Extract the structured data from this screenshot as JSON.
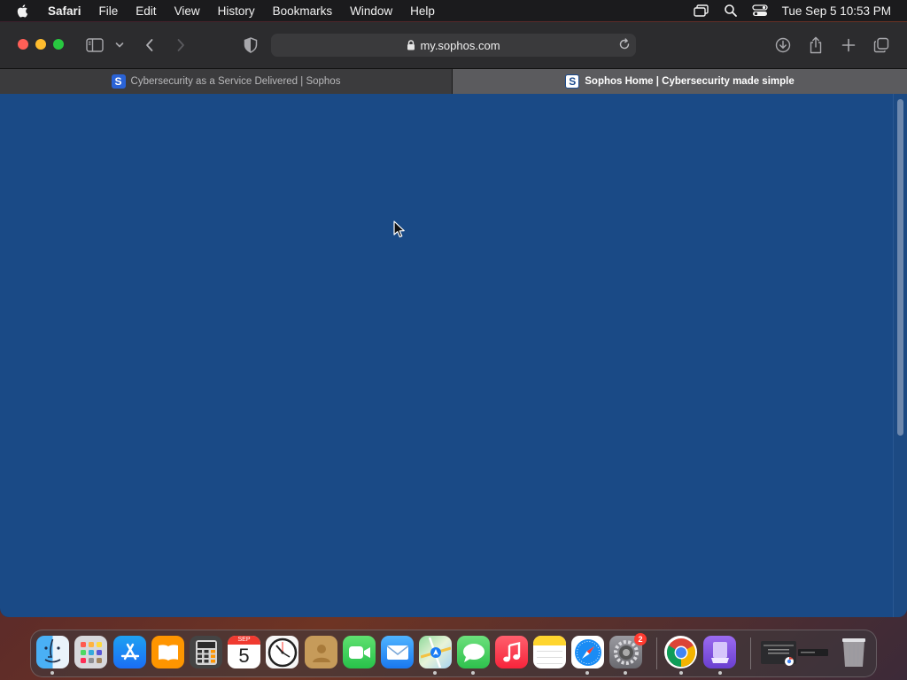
{
  "menubar": {
    "app_name": "Safari",
    "items": [
      "File",
      "Edit",
      "View",
      "History",
      "Bookmarks",
      "Window",
      "Help"
    ],
    "clock": "Tue Sep 5  10:53 PM"
  },
  "browser": {
    "url": "my.sophos.com",
    "tabs": [
      {
        "title": "Cybersecurity as a Service Delivered | Sophos",
        "favicon": "S",
        "active": false
      },
      {
        "title": "Sophos Home | Cybersecurity made simple",
        "favicon": "S",
        "active": true
      }
    ]
  },
  "page": {
    "background_color": "#1a4a86"
  },
  "dock": {
    "calendar_month": "SEP",
    "calendar_day": "5",
    "settings_badge": "2",
    "apps": [
      "Finder",
      "Launchpad",
      "App Store",
      "Books",
      "Calculator",
      "Calendar",
      "Clock",
      "Contacts",
      "FaceTime",
      "Mail",
      "Maps",
      "Messages",
      "Music",
      "Notes",
      "Safari",
      "System Settings",
      "Google Chrome",
      "Simulator",
      "Window Preview",
      "Trash"
    ]
  }
}
